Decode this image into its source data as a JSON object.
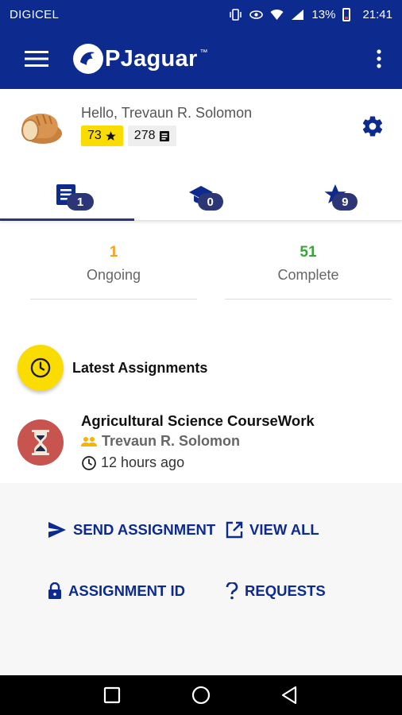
{
  "status_bar": {
    "carrier": "DIGICEL",
    "battery": "13%",
    "time": "21:41"
  },
  "app_bar": {
    "logo_prefix": "P",
    "logo_text": "PJaguar",
    "logo_tm": "™"
  },
  "profile": {
    "greeting": "Hello, Trevaun R. Solomon",
    "stars": "73",
    "books": "278"
  },
  "tabs": [
    {
      "icon": "assignments-icon",
      "count": "1"
    },
    {
      "icon": "graduation-cap-icon",
      "count": "0"
    },
    {
      "icon": "star-icon",
      "count": "9"
    }
  ],
  "stats": {
    "ongoing": {
      "value": "1",
      "label": "Ongoing"
    },
    "complete": {
      "value": "51",
      "label": "Complete"
    }
  },
  "latest": {
    "title": "Latest Assignments"
  },
  "assignment": {
    "title": "Agricultural Science CourseWork",
    "author": "Trevaun R. Solomon",
    "time": "12 hours ago"
  },
  "actions": {
    "send": "SEND ASSIGNMENT",
    "view_all": "VIEW ALL",
    "assignment_id": "ASSIGNMENT ID",
    "requests": "REQUESTS"
  },
  "colors": {
    "primary": "#0d2a8f",
    "accent_yellow": "#fbdc00",
    "badge_dark": "#2c3576",
    "ongoing": "#f5a31a",
    "complete": "#3ba43b",
    "hourglass_bg": "#c8544f"
  }
}
